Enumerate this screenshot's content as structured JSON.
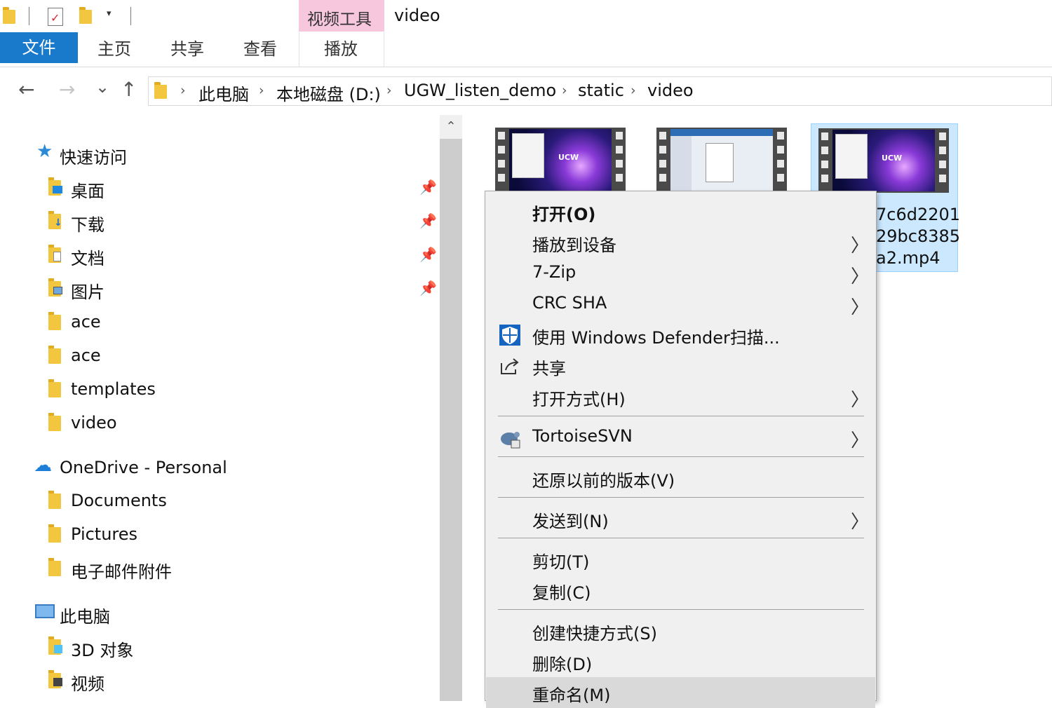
{
  "window": {
    "title": "video"
  },
  "quick_access_toolbar": {
    "dropdown_glyph": "▾"
  },
  "ribbon": {
    "context_group_label": "视频工具",
    "tabs": {
      "file": "文件",
      "home": "主页",
      "share": "共享",
      "view": "查看",
      "play": "播放"
    }
  },
  "nav": {
    "back": "←",
    "forward": "→",
    "recent": "⌄",
    "up": "↑",
    "breadcrumbs": [
      "此电脑",
      "本地磁盘 (D:)",
      "UGW_listen_demo",
      "static",
      "video"
    ],
    "crumb_separator": "›"
  },
  "navpane": {
    "quick_access": {
      "label": "快速访问",
      "icon": "star-icon"
    },
    "pinned": [
      {
        "label": "桌面",
        "icon": "desktop-folder-icon"
      },
      {
        "label": "下载",
        "icon": "downloads-folder-icon"
      },
      {
        "label": "文档",
        "icon": "documents-folder-icon"
      },
      {
        "label": "图片",
        "icon": "pictures-folder-icon"
      }
    ],
    "recent_folders": [
      "ace",
      "ace",
      "templates",
      "video"
    ],
    "onedrive": {
      "label": "OneDrive - Personal",
      "icon": "cloud-icon"
    },
    "onedrive_folders": [
      "Documents",
      "Pictures",
      "电子邮件附件"
    ],
    "this_pc": {
      "label": "此电脑",
      "icon": "computer-icon"
    },
    "this_pc_items": [
      "3D 对象",
      "视频"
    ],
    "pin_glyph": "📌"
  },
  "scrollbar": {
    "up_glyph": "⌃"
  },
  "files": [
    {
      "thumb_logo": "UCW",
      "selected": false
    },
    {
      "thumb_logo": "",
      "selected": false
    },
    {
      "thumb_logo": "UCW",
      "selected": true,
      "name_lines": [
        "7c6d2201",
        "29bc8385",
        "a2.mp4"
      ]
    }
  ],
  "context_menu": {
    "submenu_glyph": "〉",
    "items": {
      "open": "打开(O)",
      "cast": "播放到设备",
      "zip": "7-Zip",
      "crc": "CRC SHA",
      "defender": "使用 Windows Defender扫描...",
      "share": "共享",
      "open_with": "打开方式(H)",
      "svn": "TortoiseSVN",
      "restore": "还原以前的版本(V)",
      "send_to": "发送到(N)",
      "cut": "剪切(T)",
      "copy": "复制(C)",
      "shortcut": "创建快捷方式(S)",
      "delete": "删除(D)",
      "rename": "重命名(M)"
    }
  },
  "colors": {
    "accent": "#1979ca",
    "context_tab": "#f7c7dd",
    "selection": "#cce8ff",
    "menu_bg": "#f0f0f0"
  }
}
